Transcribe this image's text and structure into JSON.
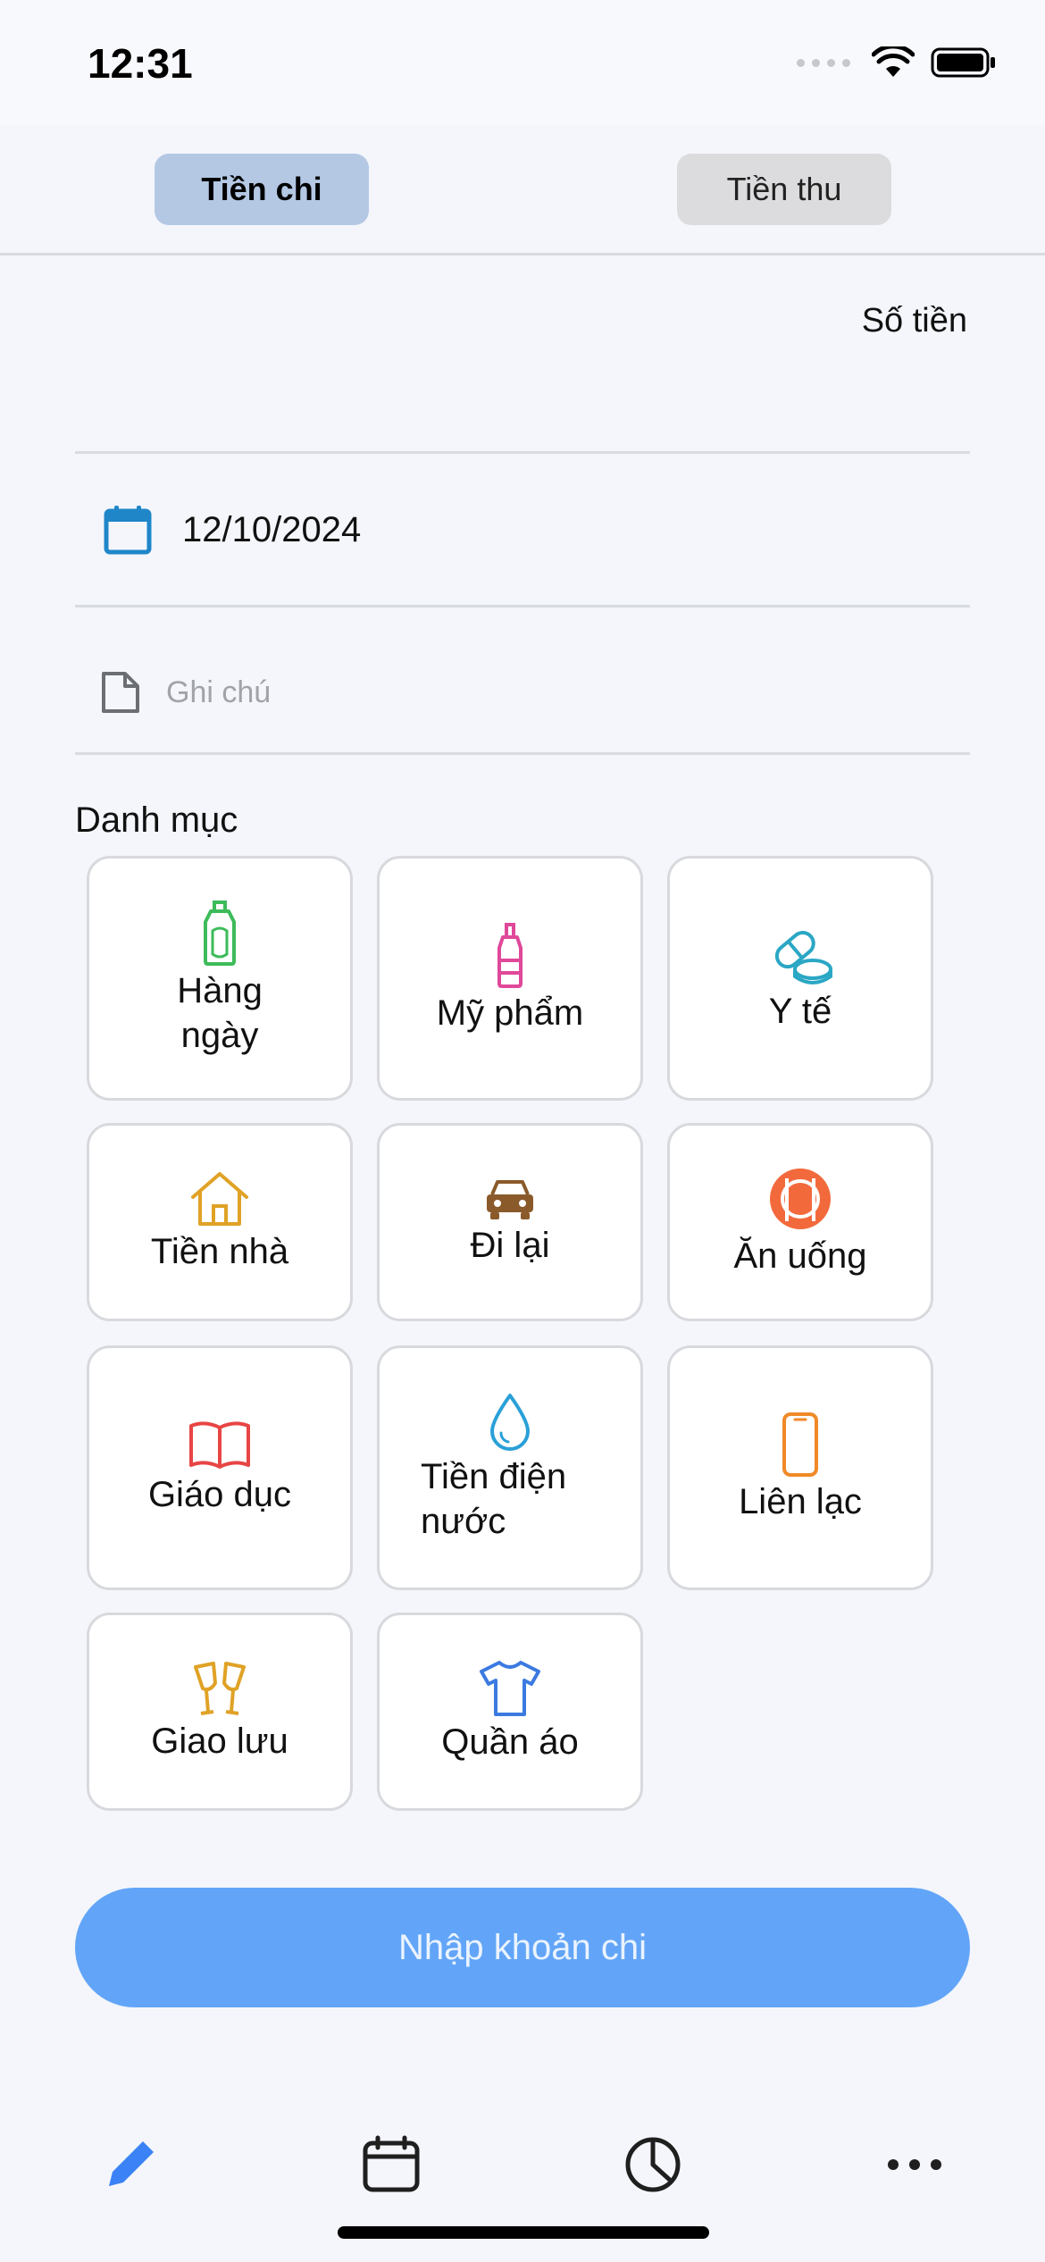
{
  "status": {
    "time": "12:31"
  },
  "tabs": {
    "expense": "Tiền chi",
    "income": "Tiền thu"
  },
  "amount": {
    "label": "Số tiền"
  },
  "date": {
    "value": "12/10/2024"
  },
  "note": {
    "placeholder": "Ghi chú"
  },
  "category": {
    "title": "Danh mục",
    "items": [
      {
        "label": "Hàng ngày",
        "icon": "detergent-bottle-icon",
        "color": "#3dbb5a"
      },
      {
        "label": "Mỹ phẩm",
        "icon": "cosmetic-bottle-icon",
        "color": "#e0489a"
      },
      {
        "label": "Y tế",
        "icon": "pills-icon",
        "color": "#2aa7c4"
      },
      {
        "label": "Tiền nhà",
        "icon": "house-icon",
        "color": "#e0a226"
      },
      {
        "label": "Đi lại",
        "icon": "car-icon",
        "color": "#8a5a2b"
      },
      {
        "label": "Ăn uống",
        "icon": "plate-fork-knife-icon",
        "color": "#f26a3c"
      },
      {
        "label": "Giáo dục",
        "icon": "open-book-icon",
        "color": "#e84545"
      },
      {
        "label": "Tiền điện nước",
        "icon": "water-drop-icon",
        "color": "#2aa0d8"
      },
      {
        "label": "Liên lạc",
        "icon": "mobile-phone-icon",
        "color": "#f08a28"
      },
      {
        "label": "Giao lưu",
        "icon": "cheers-glasses-icon",
        "color": "#e0a226"
      },
      {
        "label": "Quần áo",
        "icon": "t-shirt-icon",
        "color": "#3b7ae0"
      }
    ]
  },
  "submit": {
    "label": "Nhập khoản chi"
  },
  "nav": {
    "active_color": "#3b82f6"
  }
}
